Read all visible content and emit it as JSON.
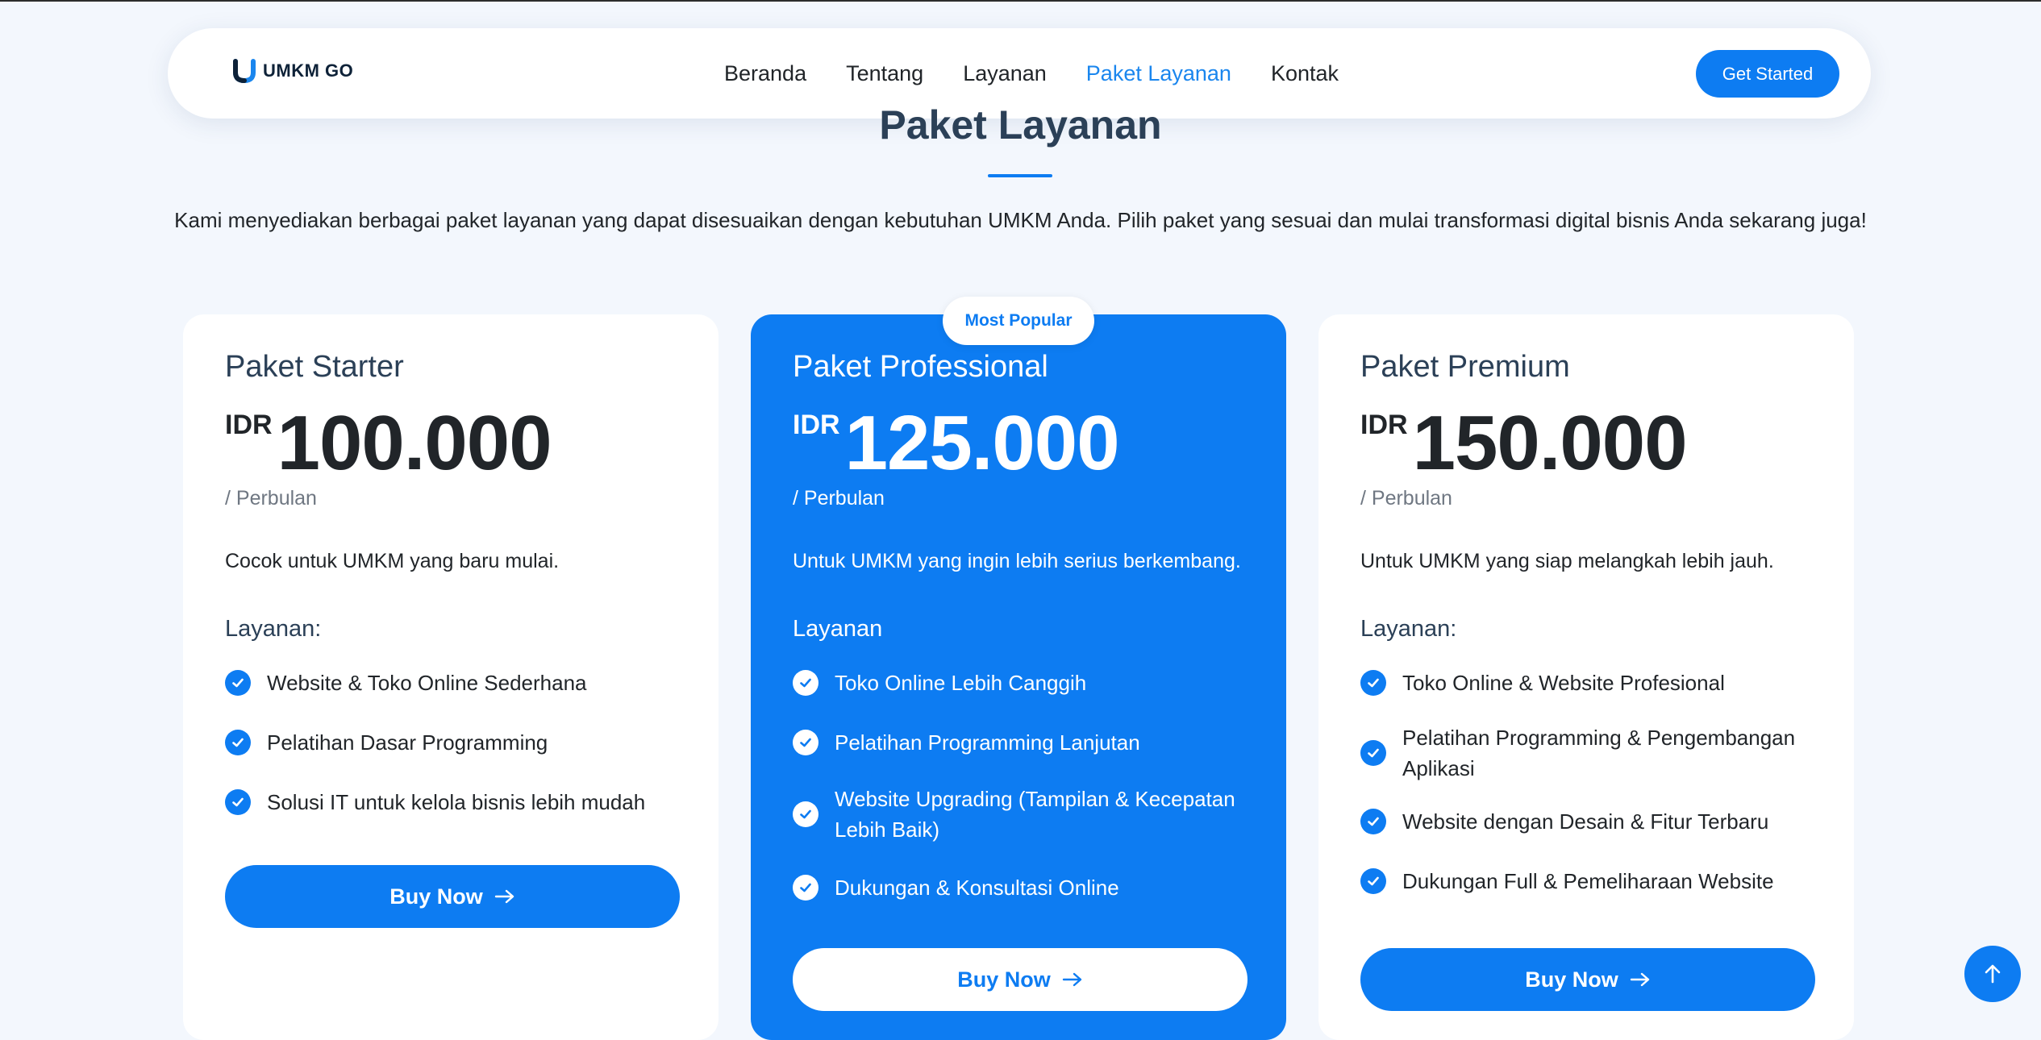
{
  "brand": {
    "name": "UMKM GO"
  },
  "nav": {
    "items": [
      {
        "label": "Beranda"
      },
      {
        "label": "Tentang"
      },
      {
        "label": "Layanan"
      },
      {
        "label": "Paket Layanan",
        "active": true
      },
      {
        "label": "Kontak"
      }
    ],
    "cta_label": "Get Started"
  },
  "section": {
    "title": "Paket Layanan",
    "description": "Kami menyediakan berbagai paket layanan yang dapat disesuaikan dengan kebutuhan UMKM Anda. Pilih paket yang sesuai dan mulai transformasi digital bisnis Anda sekarang juga!"
  },
  "plans": [
    {
      "name": "Paket Starter",
      "currency": "IDR",
      "price": "100.000",
      "period": "/ Perbulan",
      "description": "Cocok untuk UMKM yang baru mulai.",
      "features_label": "Layanan:",
      "features": [
        "Website & Toko Online Sederhana",
        "Pelatihan Dasar Programming",
        "Solusi IT untuk kelola bisnis lebih mudah"
      ],
      "button_label": "Buy Now"
    },
    {
      "name": "Paket Professional",
      "badge": "Most Popular",
      "currency": "IDR",
      "price": "125.000",
      "period": "/ Perbulan",
      "description": "Untuk UMKM yang ingin lebih serius berkembang.",
      "features_label": "Layanan",
      "features": [
        "Toko Online Lebih Canggih",
        "Pelatihan Programming Lanjutan",
        "Website Upgrading (Tampilan & Kecepatan Lebih Baik)",
        "Dukungan & Konsultasi Online"
      ],
      "button_label": "Buy Now"
    },
    {
      "name": "Paket Premium",
      "currency": "IDR",
      "price": "150.000",
      "period": "/ Perbulan",
      "description": "Untuk UMKM yang siap melangkah lebih jauh.",
      "features_label": "Layanan:",
      "features": [
        "Toko Online & Website Profesional",
        "Pelatihan Programming & Pengembangan Aplikasi",
        "Website dengan Desain & Fitur Terbaru",
        "Dukungan Full & Pemeliharaan Website"
      ],
      "button_label": "Buy Now"
    }
  ],
  "colors": {
    "primary": "#0d7cf2",
    "heading": "#2b4057",
    "background": "#f3f7fd"
  },
  "icons": {
    "feature": "check-circle-icon",
    "button": "arrow-right-icon",
    "scroll_top": "arrow-up-icon"
  }
}
